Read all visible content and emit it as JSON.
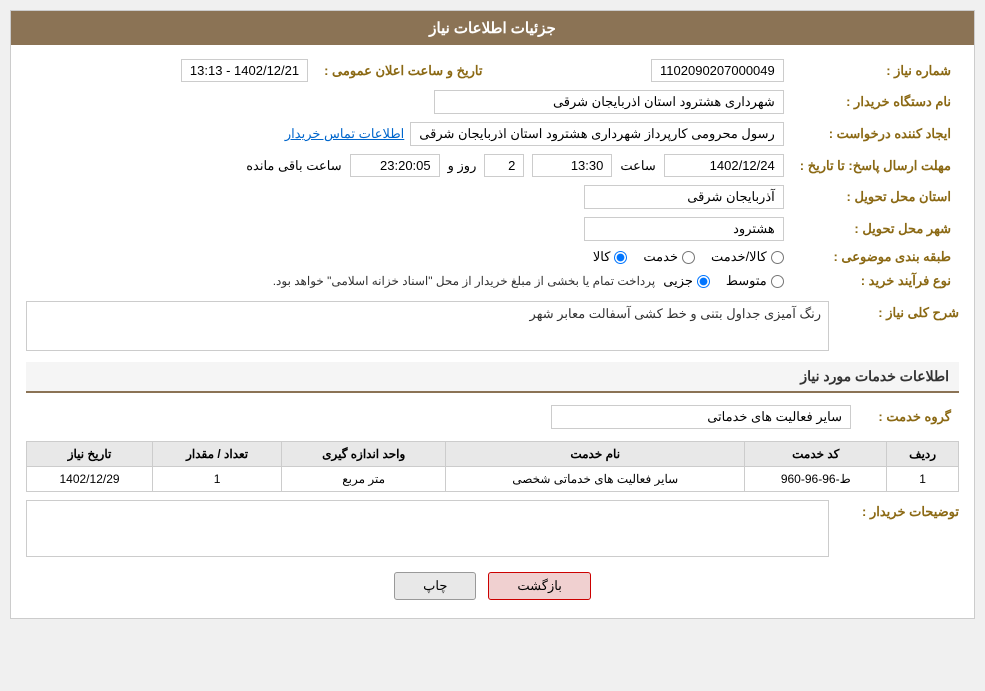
{
  "header": {
    "title": "جزئیات اطلاعات نیاز"
  },
  "fields": {
    "need_number_label": "شماره نیاز :",
    "need_number_value": "1102090207000049",
    "buyer_org_label": "نام دستگاه خریدار :",
    "buyer_org_value": "شهرداری هشترود استان اذربایجان شرقی",
    "requester_label": "ایجاد کننده درخواست :",
    "requester_value": "رسول محرومی کارپرداز شهرداری هشترود استان اذربایجان شرقی",
    "requester_link": "اطلاعات تماس خریدار",
    "announce_datetime_label": "تاریخ و ساعت اعلان عمومی :",
    "announce_datetime_value": "1402/12/21 - 13:13",
    "response_deadline_label": "مهلت ارسال پاسخ: تا تاریخ :",
    "response_date": "1402/12/24",
    "response_time_label": "ساعت",
    "response_time": "13:30",
    "response_days_label": "روز و",
    "response_days": "2",
    "response_remaining_label": "ساعت باقی مانده",
    "response_remaining": "23:20:05",
    "province_label": "استان محل تحویل :",
    "province_value": "آذربایجان شرقی",
    "city_label": "شهر محل تحویل :",
    "city_value": "هشترود",
    "category_label": "طبقه بندی موضوعی :",
    "category_options": [
      "کالا",
      "خدمت",
      "کالا/خدمت"
    ],
    "category_selected": "کالا",
    "purchase_type_label": "نوع فرآیند خرید :",
    "purchase_type_options": [
      "جزیی",
      "متوسط"
    ],
    "purchase_type_note": "پرداخت تمام یا بخشی از مبلغ خریدار از محل \"اسناد خزانه اسلامی\" خواهد بود.",
    "description_label": "شرح کلی نیاز :",
    "description_value": "رنگ آمیزی جداول بتنی و خط کشی آسفالت معابر شهر",
    "services_section_title": "اطلاعات خدمات مورد نیاز",
    "service_group_label": "گروه خدمت :",
    "service_group_value": "سایر فعالیت های خدماتی",
    "table_headers": [
      "ردیف",
      "کد خدمت",
      "نام خدمت",
      "واحد اندازه گیری",
      "تعداد / مقدار",
      "تاریخ نیاز"
    ],
    "table_rows": [
      {
        "row": "1",
        "code": "ط-96-96-960",
        "name": "سایر فعالیت های خدماتی شخصی",
        "unit": "متر مربع",
        "quantity": "1",
        "date": "1402/12/29"
      }
    ],
    "buyer_notes_label": "توضیحات خریدار :",
    "buyer_notes_value": ""
  },
  "buttons": {
    "print_label": "چاپ",
    "back_label": "بازگشت"
  }
}
